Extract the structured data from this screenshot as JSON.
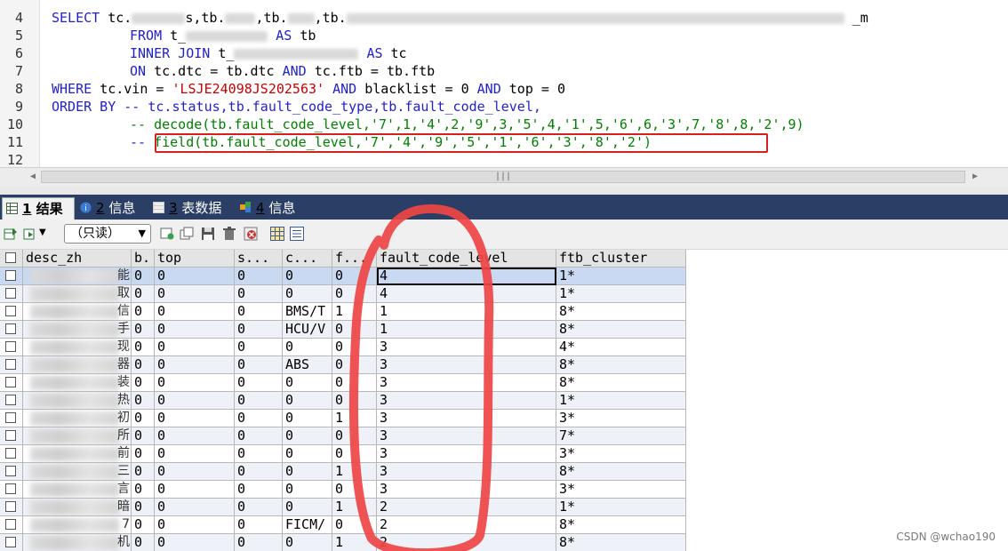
{
  "editor": {
    "lines": [
      {
        "n": "4"
      },
      {
        "n": "5"
      },
      {
        "n": "6"
      },
      {
        "n": "7"
      },
      {
        "n": "8"
      },
      {
        "n": "9"
      },
      {
        "n": "10"
      },
      {
        "n": "11"
      },
      {
        "n": "12"
      }
    ],
    "line4": {
      "kw": "SELECT",
      "text1": "tc.",
      "text2": "s,tb.",
      "text3": ",tb.",
      "text4": ",tb.",
      "tail": "_m"
    },
    "line5": {
      "kw": "FROM",
      "t": "t_",
      "as": "AS",
      "alias": "tb"
    },
    "line6": {
      "kw": "INNER JOIN",
      "t": "t_",
      "as": "AS",
      "alias": "tc"
    },
    "line7": {
      "kw": "ON",
      "a": "tc.dtc = tb.dtc",
      "and": "AND",
      "b": "tc.ftb = tb.ftb"
    },
    "line8": {
      "kw": "WHERE",
      "a": "tc.vin = ",
      "vin": "'LSJE24098JS202563'",
      "and1": "AND",
      "b": "blacklist = 0",
      "and2": "AND",
      "c": "top = 0"
    },
    "line9": {
      "kw": "ORDER BY",
      "comment": "-- tc.status,tb.fault_code_type,tb.fault_code_level,"
    },
    "line10": {
      "comment": "-- decode(tb.fault_code_level,'7',1,'4',2,'9',3,'5',4,'1',5,'6',6,'3',7,'8',8,'2',9)"
    },
    "line11": {
      "dash": "--",
      "comment": "field(tb.fault_code_level,'7','4','9','5','1','6','3','8','2')"
    }
  },
  "tabs": [
    {
      "num": "1",
      "label": " 结果"
    },
    {
      "num": "2",
      "label": " 信息"
    },
    {
      "num": "3",
      "label": " 表数据"
    },
    {
      "num": "4",
      "label": " 信息"
    }
  ],
  "toolbar": {
    "readonly_label": "（只读）",
    "arrow": "▼"
  },
  "grid": {
    "columns": [
      "desc_zh",
      "b.",
      "top",
      "s...",
      "c...",
      "f...",
      "fault_code_level",
      "ftb_cluster"
    ],
    "rows": [
      [
        "0",
        "0",
        "0",
        "0",
        "0",
        "4",
        "1*"
      ],
      [
        "0",
        "0",
        "0",
        "0",
        "0",
        "4",
        "1*"
      ],
      [
        "0",
        "0",
        "0",
        "BMS/T",
        "1",
        "1",
        "8*"
      ],
      [
        "0",
        "0",
        "0",
        "HCU/V",
        "0",
        "1",
        "8*"
      ],
      [
        "0",
        "0",
        "0",
        "0",
        "0",
        "3",
        "4*"
      ],
      [
        "0",
        "0",
        "0",
        "ABS",
        "0",
        "3",
        "8*"
      ],
      [
        "0",
        "0",
        "0",
        "0",
        "0",
        "3",
        "8*"
      ],
      [
        "0",
        "0",
        "0",
        "0",
        "0",
        "3",
        "1*"
      ],
      [
        "0",
        "0",
        "0",
        "0",
        "1",
        "3",
        "3*"
      ],
      [
        "0",
        "0",
        "0",
        "0",
        "0",
        "3",
        "7*"
      ],
      [
        "0",
        "0",
        "0",
        "0",
        "0",
        "3",
        "3*"
      ],
      [
        "0",
        "0",
        "0",
        "0",
        "1",
        "3",
        "8*"
      ],
      [
        "0",
        "0",
        "0",
        "0",
        "0",
        "3",
        "3*"
      ],
      [
        "0",
        "0",
        "0",
        "0",
        "1",
        "2",
        "1*"
      ],
      [
        "0",
        "0",
        "0",
        "FICM/",
        "0",
        "2",
        "8*"
      ],
      [
        "0",
        "0",
        "0",
        "0",
        "1",
        "2",
        "8*"
      ]
    ],
    "row_tail_glyphs": [
      "能",
      "取",
      "信",
      "手",
      "现",
      "器",
      "装",
      "热",
      "初",
      "所",
      "前",
      "三",
      "言",
      "暗",
      "7",
      "机"
    ]
  },
  "watermark": "CSDN @wchao190",
  "colors": {
    "keyword": "#2222cc",
    "string": "#c80000",
    "comment": "#008000",
    "tabbar": "#2b3f66",
    "annotation": "#e53935"
  }
}
